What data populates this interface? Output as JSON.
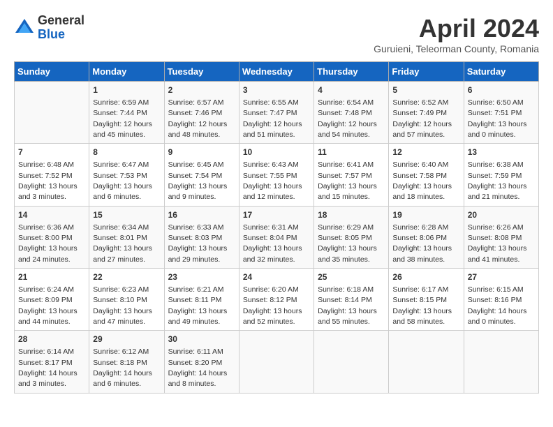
{
  "header": {
    "logo_general": "General",
    "logo_blue": "Blue",
    "title": "April 2024",
    "location": "Guruieni, Teleorman County, Romania"
  },
  "days_of_week": [
    "Sunday",
    "Monday",
    "Tuesday",
    "Wednesday",
    "Thursday",
    "Friday",
    "Saturday"
  ],
  "weeks": [
    [
      {
        "day": "",
        "info": ""
      },
      {
        "day": "1",
        "info": "Sunrise: 6:59 AM\nSunset: 7:44 PM\nDaylight: 12 hours\nand 45 minutes."
      },
      {
        "day": "2",
        "info": "Sunrise: 6:57 AM\nSunset: 7:46 PM\nDaylight: 12 hours\nand 48 minutes."
      },
      {
        "day": "3",
        "info": "Sunrise: 6:55 AM\nSunset: 7:47 PM\nDaylight: 12 hours\nand 51 minutes."
      },
      {
        "day": "4",
        "info": "Sunrise: 6:54 AM\nSunset: 7:48 PM\nDaylight: 12 hours\nand 54 minutes."
      },
      {
        "day": "5",
        "info": "Sunrise: 6:52 AM\nSunset: 7:49 PM\nDaylight: 12 hours\nand 57 minutes."
      },
      {
        "day": "6",
        "info": "Sunrise: 6:50 AM\nSunset: 7:51 PM\nDaylight: 13 hours\nand 0 minutes."
      }
    ],
    [
      {
        "day": "7",
        "info": "Sunrise: 6:48 AM\nSunset: 7:52 PM\nDaylight: 13 hours\nand 3 minutes."
      },
      {
        "day": "8",
        "info": "Sunrise: 6:47 AM\nSunset: 7:53 PM\nDaylight: 13 hours\nand 6 minutes."
      },
      {
        "day": "9",
        "info": "Sunrise: 6:45 AM\nSunset: 7:54 PM\nDaylight: 13 hours\nand 9 minutes."
      },
      {
        "day": "10",
        "info": "Sunrise: 6:43 AM\nSunset: 7:55 PM\nDaylight: 13 hours\nand 12 minutes."
      },
      {
        "day": "11",
        "info": "Sunrise: 6:41 AM\nSunset: 7:57 PM\nDaylight: 13 hours\nand 15 minutes."
      },
      {
        "day": "12",
        "info": "Sunrise: 6:40 AM\nSunset: 7:58 PM\nDaylight: 13 hours\nand 18 minutes."
      },
      {
        "day": "13",
        "info": "Sunrise: 6:38 AM\nSunset: 7:59 PM\nDaylight: 13 hours\nand 21 minutes."
      }
    ],
    [
      {
        "day": "14",
        "info": "Sunrise: 6:36 AM\nSunset: 8:00 PM\nDaylight: 13 hours\nand 24 minutes."
      },
      {
        "day": "15",
        "info": "Sunrise: 6:34 AM\nSunset: 8:01 PM\nDaylight: 13 hours\nand 27 minutes."
      },
      {
        "day": "16",
        "info": "Sunrise: 6:33 AM\nSunset: 8:03 PM\nDaylight: 13 hours\nand 29 minutes."
      },
      {
        "day": "17",
        "info": "Sunrise: 6:31 AM\nSunset: 8:04 PM\nDaylight: 13 hours\nand 32 minutes."
      },
      {
        "day": "18",
        "info": "Sunrise: 6:29 AM\nSunset: 8:05 PM\nDaylight: 13 hours\nand 35 minutes."
      },
      {
        "day": "19",
        "info": "Sunrise: 6:28 AM\nSunset: 8:06 PM\nDaylight: 13 hours\nand 38 minutes."
      },
      {
        "day": "20",
        "info": "Sunrise: 6:26 AM\nSunset: 8:08 PM\nDaylight: 13 hours\nand 41 minutes."
      }
    ],
    [
      {
        "day": "21",
        "info": "Sunrise: 6:24 AM\nSunset: 8:09 PM\nDaylight: 13 hours\nand 44 minutes."
      },
      {
        "day": "22",
        "info": "Sunrise: 6:23 AM\nSunset: 8:10 PM\nDaylight: 13 hours\nand 47 minutes."
      },
      {
        "day": "23",
        "info": "Sunrise: 6:21 AM\nSunset: 8:11 PM\nDaylight: 13 hours\nand 49 minutes."
      },
      {
        "day": "24",
        "info": "Sunrise: 6:20 AM\nSunset: 8:12 PM\nDaylight: 13 hours\nand 52 minutes."
      },
      {
        "day": "25",
        "info": "Sunrise: 6:18 AM\nSunset: 8:14 PM\nDaylight: 13 hours\nand 55 minutes."
      },
      {
        "day": "26",
        "info": "Sunrise: 6:17 AM\nSunset: 8:15 PM\nDaylight: 13 hours\nand 58 minutes."
      },
      {
        "day": "27",
        "info": "Sunrise: 6:15 AM\nSunset: 8:16 PM\nDaylight: 14 hours\nand 0 minutes."
      }
    ],
    [
      {
        "day": "28",
        "info": "Sunrise: 6:14 AM\nSunset: 8:17 PM\nDaylight: 14 hours\nand 3 minutes."
      },
      {
        "day": "29",
        "info": "Sunrise: 6:12 AM\nSunset: 8:18 PM\nDaylight: 14 hours\nand 6 minutes."
      },
      {
        "day": "30",
        "info": "Sunrise: 6:11 AM\nSunset: 8:20 PM\nDaylight: 14 hours\nand 8 minutes."
      },
      {
        "day": "",
        "info": ""
      },
      {
        "day": "",
        "info": ""
      },
      {
        "day": "",
        "info": ""
      },
      {
        "day": "",
        "info": ""
      }
    ]
  ]
}
